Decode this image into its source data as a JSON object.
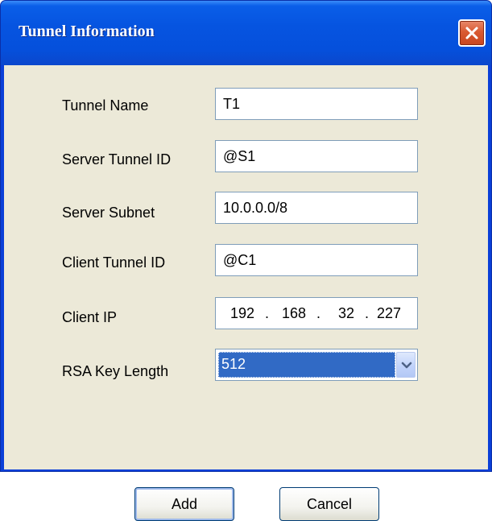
{
  "window": {
    "title": "Tunnel Information"
  },
  "fields": {
    "tunnel_name": {
      "label": "Tunnel Name",
      "value": "T1"
    },
    "server_tunnel_id": {
      "label": "Server Tunnel ID",
      "value": "@S1"
    },
    "server_subnet": {
      "label": "Server Subnet",
      "value": "10.0.0.0/8"
    },
    "client_tunnel_id": {
      "label": "Client Tunnel ID",
      "value": "@C1"
    },
    "client_ip": {
      "label": "Client IP",
      "octets": [
        "192",
        "168",
        "32",
        "227"
      ]
    },
    "rsa_key_length": {
      "label": "RSA Key Length",
      "selected": "512"
    }
  },
  "buttons": {
    "add": "Add",
    "cancel": "Cancel"
  },
  "colors": {
    "titlebar": "#0654e0",
    "dialog_bg": "#ece9d8",
    "selection": "#316ac5",
    "close_button": "#d95a32"
  },
  "icons": {
    "close": "close-x-icon",
    "dropdown": "chevron-down-icon"
  }
}
